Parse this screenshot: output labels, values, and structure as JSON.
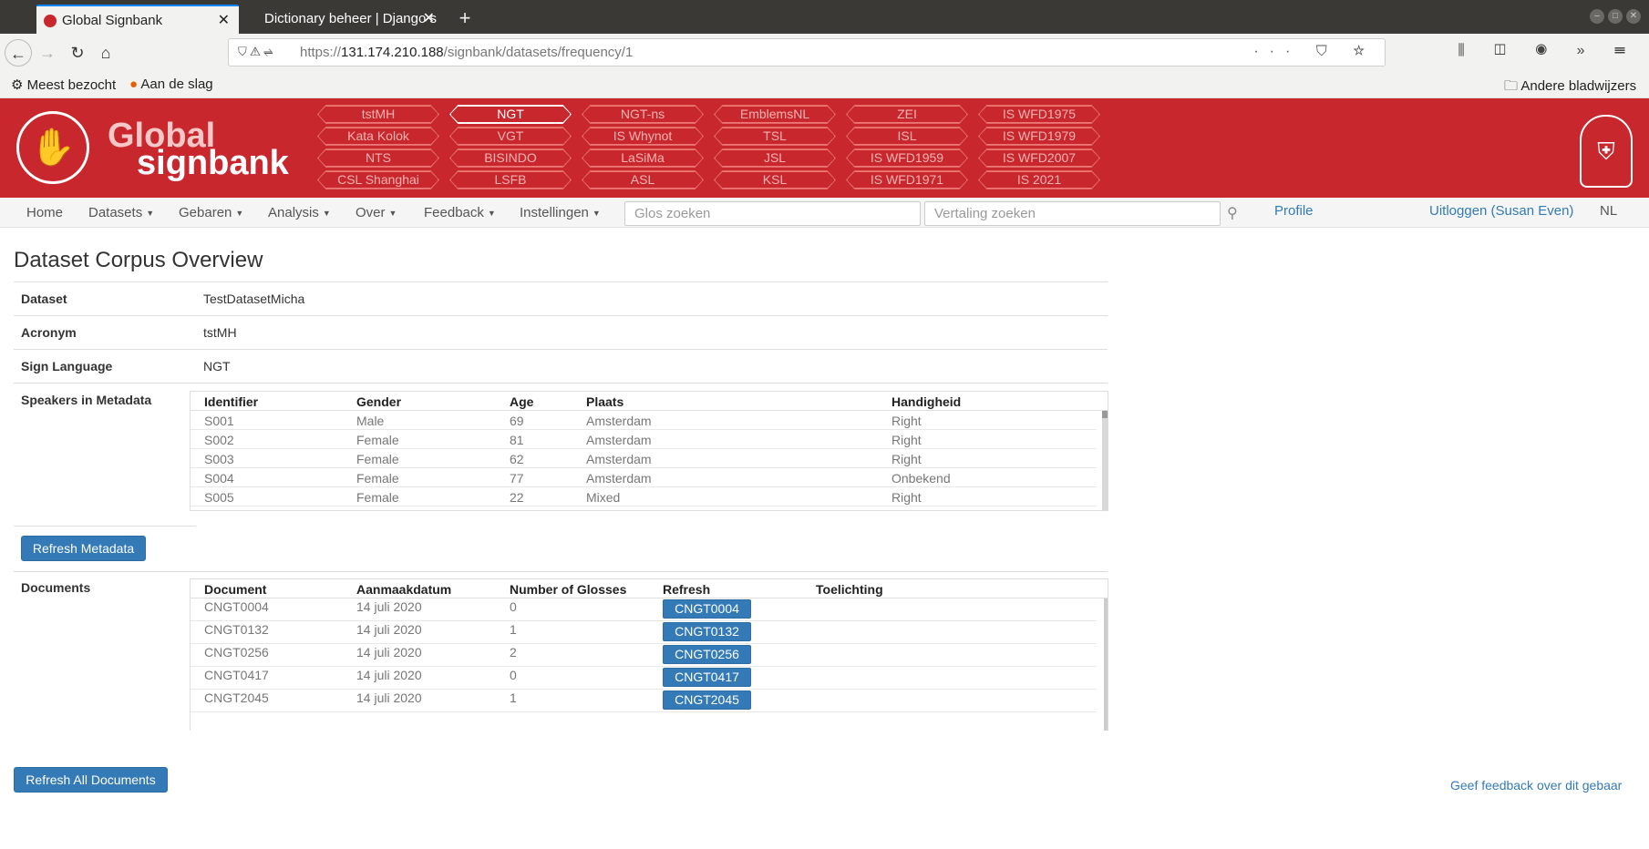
{
  "browser": {
    "tabs": [
      {
        "title": "Global Signbank"
      },
      {
        "title": "Dictionary beheer | Django s"
      }
    ],
    "url_prefix": "https://",
    "url_host": "131.174.210.188",
    "url_path": "/signbank/datasets/frequency/1",
    "bookmarks": {
      "most_visited": "Meest bezocht",
      "getting_started": "Aan de slag",
      "other": "Andere bladwijzers"
    }
  },
  "header": {
    "logo_line1": "Global",
    "logo_line2": "signbank",
    "datasets": [
      [
        "tstMH",
        "NGT",
        "NGT-ns",
        "EmblemsNL",
        "ZEI",
        "IS WFD1975"
      ],
      [
        "Kata Kolok",
        "VGT",
        "IS Whynot",
        "TSL",
        "ISL",
        "IS WFD1979"
      ],
      [
        "NTS",
        "BISINDO",
        "LaSiMa",
        "JSL",
        "IS WFD1959",
        "IS WFD2007"
      ],
      [
        "CSL Shanghai",
        "LSFB",
        "ASL",
        "KSL",
        "IS WFD1971",
        "IS 2021"
      ]
    ],
    "selected_dataset": "NGT"
  },
  "menu": {
    "home": "Home",
    "datasets": "Datasets",
    "gebaren": "Gebaren",
    "analysis": "Analysis",
    "over": "Over",
    "feedback": "Feedback",
    "instellingen": "Instellingen",
    "gloss_search_placeholder": "Glos zoeken",
    "translation_search_placeholder": "Vertaling zoeken",
    "profile": "Profile",
    "logout": "Uitloggen (Susan Even)",
    "language": "NL"
  },
  "main": {
    "title": "Dataset Corpus Overview",
    "fields": {
      "dataset_label": "Dataset",
      "dataset_value": "TestDatasetMicha",
      "acronym_label": "Acronym",
      "acronym_value": "tstMH",
      "sign_language_label": "Sign Language",
      "sign_language_value": "NGT",
      "speakers_label": "Speakers in Metadata",
      "documents_label": "Documents"
    },
    "speakers": {
      "headers": [
        "Identifier",
        "Gender",
        "Age",
        "Plaats",
        "Handigheid"
      ],
      "rows": [
        [
          "S001",
          "Male",
          "69",
          "Amsterdam",
          "Right"
        ],
        [
          "S002",
          "Female",
          "81",
          "Amsterdam",
          "Right"
        ],
        [
          "S003",
          "Female",
          "62",
          "Amsterdam",
          "Right"
        ],
        [
          "S004",
          "Female",
          "77",
          "Amsterdam",
          "Onbekend"
        ],
        [
          "S005",
          "Female",
          "22",
          "Mixed",
          "Right"
        ]
      ]
    },
    "refresh_metadata": "Refresh Metadata",
    "documents": {
      "headers": [
        "Document",
        "Aanmaakdatum",
        "Number of Glosses",
        "Refresh",
        "Toelichting"
      ],
      "rows": [
        [
          "CNGT0004",
          "14 juli 2020",
          "0",
          "CNGT0004"
        ],
        [
          "CNGT0132",
          "14 juli 2020",
          "1",
          "CNGT0132"
        ],
        [
          "CNGT0256",
          "14 juli 2020",
          "2",
          "CNGT0256"
        ],
        [
          "CNGT0417",
          "14 juli 2020",
          "0",
          "CNGT0417"
        ],
        [
          "CNGT2045",
          "14 juli 2020",
          "1",
          "CNGT2045"
        ]
      ]
    },
    "refresh_all": "Refresh All Documents",
    "feedback_link": "Geef feedback over dit gebaar"
  },
  "colors": {
    "brand_red": "#c8282d",
    "link_blue": "#337ab7"
  }
}
